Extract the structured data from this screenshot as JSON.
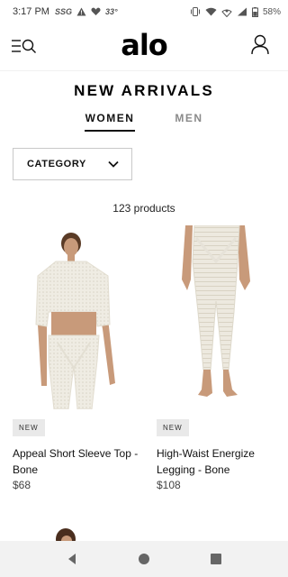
{
  "status_bar": {
    "time": "3:17 PM",
    "left_icons": [
      "ssg-icon",
      "alert-icon",
      "heart-check-icon",
      "temperature"
    ],
    "temperature": "33°",
    "battery": "58%"
  },
  "header": {
    "logo": "alo"
  },
  "page": {
    "title": "NEW ARRIVALS"
  },
  "tabs": [
    {
      "label": "WOMEN",
      "selected": true
    },
    {
      "label": "MEN",
      "selected": false
    }
  ],
  "filter": {
    "category_label": "CATEGORY"
  },
  "results": {
    "count_text": "123 products"
  },
  "products": [
    {
      "badge": "NEW",
      "name": "Appeal Short Sleeve Top - Bone",
      "price": "$68"
    },
    {
      "badge": "NEW",
      "name": "High-Waist Energize Legging - Bone",
      "price": "$108"
    }
  ],
  "colors": {
    "accent": "#111111",
    "inactive_tab": "#8a8a8a",
    "badge_bg": "#e9e9e9",
    "product_bone": "#ece9df",
    "navbar_bg": "#f2f2f2"
  }
}
